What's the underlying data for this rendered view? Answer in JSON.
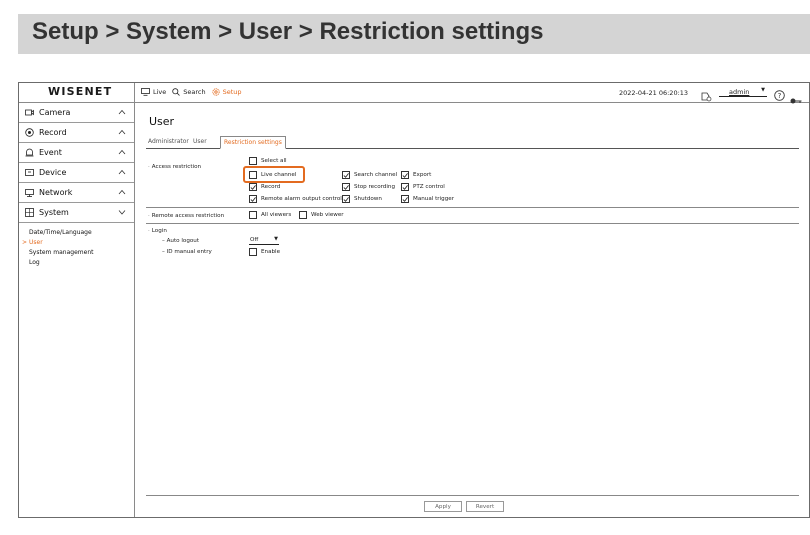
{
  "banner": {
    "title": "Setup > System > User > Restriction settings"
  },
  "topbar": {
    "logo": "WISENET",
    "nav": [
      {
        "label": "Live",
        "icon": "monitor-icon"
      },
      {
        "label": "Search",
        "icon": "search-icon"
      },
      {
        "label": "Setup",
        "icon": "gear-icon",
        "active": true
      }
    ],
    "datetime": "2022-04-21 06:20:13",
    "user": "admin"
  },
  "sidebar": {
    "menu": [
      {
        "label": "Camera",
        "icon": "camera-icon",
        "expanded": false
      },
      {
        "label": "Record",
        "icon": "record-icon",
        "expanded": false
      },
      {
        "label": "Event",
        "icon": "event-icon",
        "expanded": false
      },
      {
        "label": "Device",
        "icon": "device-icon",
        "expanded": false
      },
      {
        "label": "Network",
        "icon": "network-icon",
        "expanded": false
      },
      {
        "label": "System",
        "icon": "system-icon",
        "expanded": true
      }
    ],
    "submenu": [
      {
        "label": "Date/Time/Language",
        "active": false
      },
      {
        "label": "User",
        "active": true
      },
      {
        "label": "System management",
        "active": false
      },
      {
        "label": "Log",
        "active": false
      }
    ]
  },
  "main": {
    "title": "User",
    "tabs": [
      "Administrator",
      "User",
      "Restriction settings"
    ],
    "active_tab": 2,
    "access_restriction": {
      "label": "Access restriction",
      "select_all": {
        "label": "Select all",
        "checked": false
      },
      "items": [
        {
          "label": "Live channel",
          "checked": false
        },
        {
          "label": "Search channel",
          "checked": true
        },
        {
          "label": "Export",
          "checked": true
        },
        {
          "label": "Record",
          "checked": true
        },
        {
          "label": "Stop recording",
          "checked": true
        },
        {
          "label": "PTZ control",
          "checked": true
        },
        {
          "label": "Remote alarm output control",
          "checked": true
        },
        {
          "label": "Shutdown",
          "checked": true
        },
        {
          "label": "Manual trigger",
          "checked": true
        }
      ]
    },
    "remote_access": {
      "label": "Remote access restriction",
      "items": [
        {
          "label": "All viewers",
          "checked": false
        },
        {
          "label": "Web viewer",
          "checked": false
        }
      ]
    },
    "login": {
      "label": "Login",
      "auto_logout_label": "Auto logout",
      "auto_logout_value": "Off",
      "id_manual_label": "ID manual entry",
      "id_manual_option": {
        "label": "Enable",
        "checked": false
      }
    },
    "buttons": {
      "apply": "Apply",
      "revert": "Revert"
    }
  },
  "colors": {
    "accent": "#e36b20",
    "banner": "#d4d4d4"
  }
}
